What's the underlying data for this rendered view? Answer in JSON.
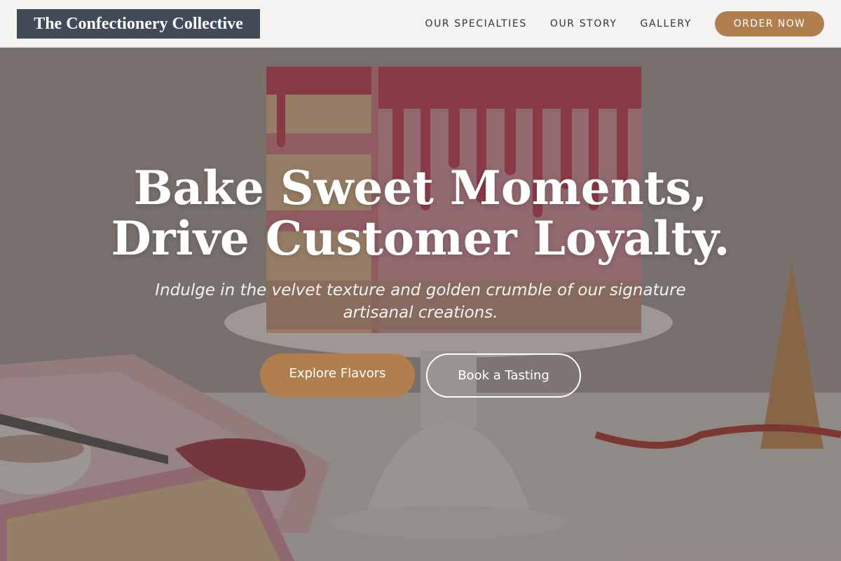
{
  "navbar": {
    "brand": "The Confectionery Collective",
    "links": [
      {
        "label": "OUR SPECIALTIES"
      },
      {
        "label": "OUR STORY"
      },
      {
        "label": "GALLERY"
      }
    ],
    "order_button": "ORDER NOW"
  },
  "hero": {
    "headline_line1": "Bake Sweet Moments,",
    "headline_line2": "Drive Customer Loyalty.",
    "subtitle": "Indulge in the velvet texture and golden crumble of our signature artisanal creations.",
    "primary_cta": "Explore Flavors",
    "secondary_cta": "Book a Tasting"
  },
  "colors": {
    "accent": "#b17f4e",
    "brand_badge": "#424a57",
    "nav_background": "#f4f3f2",
    "nav_text": "#2e3440"
  },
  "icons": {
    "background_image": "cake-photo"
  }
}
